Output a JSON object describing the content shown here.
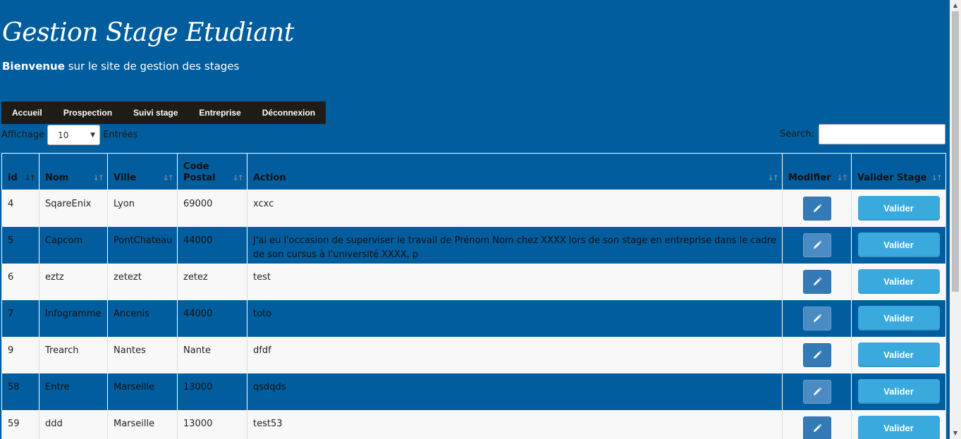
{
  "header": {
    "title": "Gestion Stage Etudiant",
    "welcome_bold": "Bienvenue",
    "welcome_rest": " sur le site de gestion des stages"
  },
  "nav": {
    "items": [
      "Accueil",
      "Prospection",
      "Suivi stage",
      "Entreprise",
      "Déconnexion"
    ]
  },
  "controls": {
    "length_label_before": "Affichage",
    "length_value": "10",
    "length_label_after": "Entrées",
    "search_label": "Search:",
    "search_value": ""
  },
  "table": {
    "columns": [
      "id",
      "Nom",
      "Ville",
      "Code Postal",
      "Action",
      "Modifier",
      "Valider Stage"
    ],
    "sorted_column": "id",
    "button_label": "Valider",
    "rows": [
      {
        "id": "4",
        "nom": "SqareEnix",
        "ville": "Lyon",
        "cp": "69000",
        "action": "xcxc"
      },
      {
        "id": "5",
        "nom": "Capcom",
        "ville": "PontChateau",
        "cp": "44000",
        "action": "J'ai eu l'occasion de superviser le travail de Prénom Nom chez XXXX lors de son stage en entreprise dans le cadre de son cursus à l'université XXXX, p"
      },
      {
        "id": "6",
        "nom": "eztz",
        "ville": "zetezt",
        "cp": "zetez",
        "action": "test"
      },
      {
        "id": "7",
        "nom": "Infogramme",
        "ville": "Ancenis",
        "cp": "44000",
        "action": "toto"
      },
      {
        "id": "9",
        "nom": "Trearch",
        "ville": "Nantes",
        "cp": "Nante",
        "action": "dfdf"
      },
      {
        "id": "58",
        "nom": "Entre",
        "ville": "Marseille",
        "cp": "13000",
        "action": "qsdqds"
      },
      {
        "id": "59",
        "nom": "ddd",
        "ville": "Marseille",
        "cp": "13000",
        "action": "test53"
      }
    ]
  },
  "colors": {
    "background": "#015d9d",
    "navbar": "#1f1b17",
    "edit_button": "#337ab7",
    "valider_button": "#3aa9de"
  },
  "icons": {
    "edit": "pencil-icon",
    "sort": "sort-arrows-icon",
    "select": "caret-down-icon"
  }
}
